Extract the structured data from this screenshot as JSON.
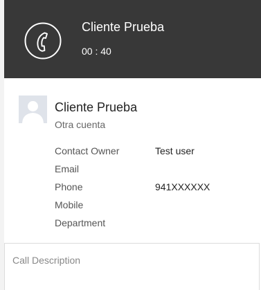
{
  "call": {
    "caller_name": "Cliente Prueba",
    "timer": "00 : 40",
    "icon": "phone-handset-icon"
  },
  "contact": {
    "name": "Cliente Prueba",
    "account": "Otra cuenta",
    "avatar_icon": "avatar-placeholder-icon",
    "fields": [
      {
        "label": "Contact Owner",
        "value": "Test user"
      },
      {
        "label": "Email",
        "value": ""
      },
      {
        "label": "Phone",
        "value": "941XXXXXX"
      },
      {
        "label": "Mobile",
        "value": ""
      },
      {
        "label": "Department",
        "value": ""
      }
    ]
  },
  "description": {
    "placeholder": "Call Description",
    "value": ""
  },
  "colors": {
    "header_background": "#383838",
    "header_text": "#ffffff",
    "page_background": "#ffffff"
  }
}
